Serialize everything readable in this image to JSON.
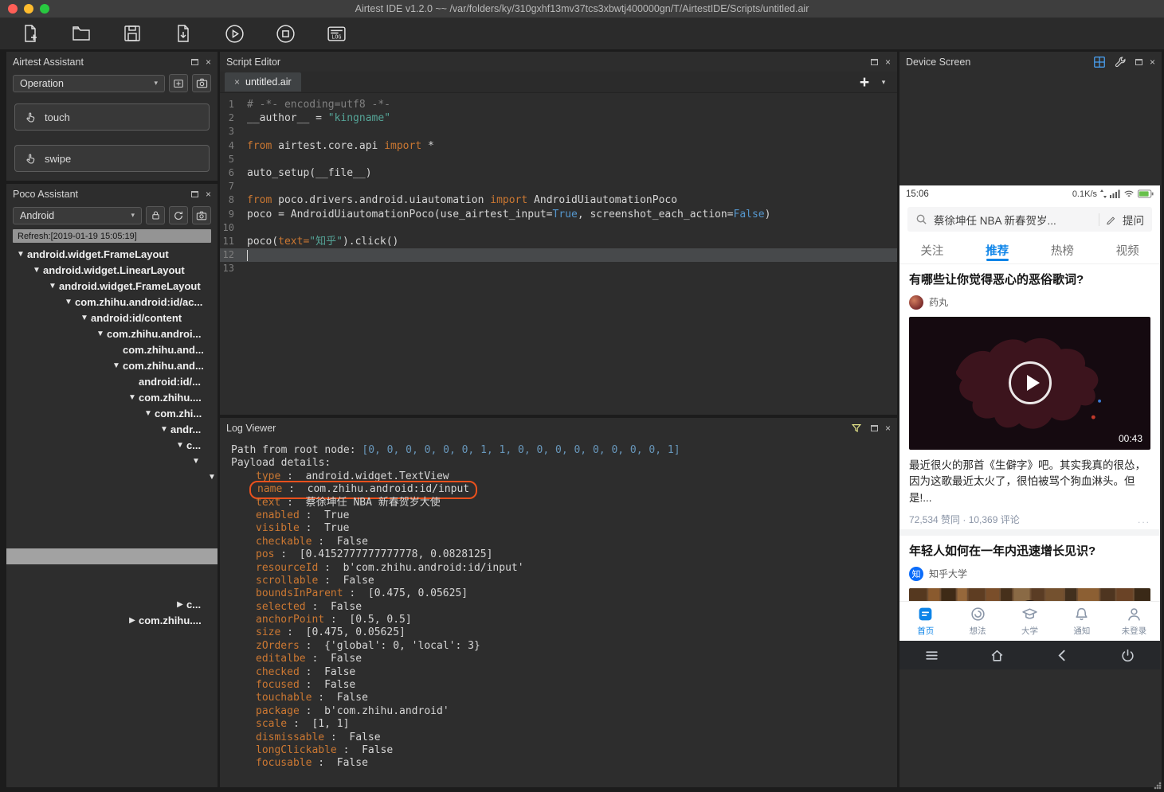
{
  "glyphs": {
    "close": "×",
    "caret": "▾",
    "plus": "+",
    "expanded": "▼",
    "collapsed": "▶"
  },
  "colors": {
    "accent_blue": "#0d84e8",
    "keyword_orange": "#cc7832",
    "string_teal": "#55a598",
    "bool_blue": "#5597ce",
    "highlight_ring": "#e9511d"
  },
  "titlebar": {
    "title": "Airtest IDE v1.2.0 ~~ /var/folders/ky/310gxhf13mv37tcs3xbwtj400000gn/T/AirtestIDE/Scripts/untitled.air"
  },
  "toolbar": {
    "buttons": [
      "new-script",
      "open-script",
      "save-script",
      "export-script",
      "run-script",
      "stop-script",
      "view-log"
    ]
  },
  "airtest_assistant": {
    "title": "Airtest Assistant",
    "mode_selected": "Operation",
    "touch_label": "touch",
    "swipe_label": "swipe"
  },
  "poco_assistant": {
    "title": "Poco Assistant",
    "platform_selected": "Android",
    "refresh_label": "Refresh:[2019-01-19 15:05:19]",
    "tree": [
      {
        "level": 0,
        "label": "android.widget.FrameLayout",
        "state": "expanded"
      },
      {
        "level": 1,
        "label": "android.widget.LinearLayout",
        "state": "expanded"
      },
      {
        "level": 2,
        "label": "android.widget.FrameLayout",
        "state": "expanded"
      },
      {
        "level": 3,
        "label": "com.zhihu.android:id/ac...",
        "state": "expanded"
      },
      {
        "level": 4,
        "label": "android:id/content",
        "state": "expanded"
      },
      {
        "level": 5,
        "label": "com.zhihu.androi...",
        "state": "expanded"
      },
      {
        "level": 6,
        "label": "com.zhihu.and...",
        "state": "leaf"
      },
      {
        "level": 6,
        "label": "com.zhihu.and...",
        "state": "expanded"
      },
      {
        "level": 7,
        "label": "android:id/...",
        "state": "leaf"
      },
      {
        "level": 7,
        "label": "com.zhihu....",
        "state": "expanded"
      },
      {
        "level": 8,
        "label": "com.zhi...",
        "state": "expanded"
      },
      {
        "level": 9,
        "label": "andr...",
        "state": "expanded"
      },
      {
        "level": 10,
        "label": "c...",
        "state": "expanded"
      },
      {
        "level": 11,
        "label": "",
        "state": "expanded"
      },
      {
        "level": 12,
        "label": "",
        "state": "expanded"
      },
      {
        "level": 13,
        "label": "",
        "state": "expanded"
      },
      {
        "level": 14,
        "label": "",
        "state": "expanded"
      },
      {
        "level": 15,
        "label": "",
        "state": "expanded"
      },
      {
        "level": 16,
        "label": "",
        "state": "expanded"
      },
      {
        "level": 17,
        "label": "",
        "state": "expanded",
        "selected": true
      },
      {
        "level": 18,
        "label": "",
        "state": "expanded"
      },
      {
        "level": 19,
        "label": "",
        "state": "expanded"
      },
      {
        "level": 10,
        "label": "c...",
        "state": "collapsed"
      },
      {
        "level": 7,
        "label": "com.zhihu....",
        "state": "collapsed"
      }
    ]
  },
  "script_editor": {
    "title": "Script Editor",
    "tab_label": "untitled.air",
    "lines": [
      {
        "no": 1,
        "segs": [
          {
            "t": "# -*- encoding=utf8 -*-",
            "c": "com"
          }
        ]
      },
      {
        "no": 2,
        "segs": [
          {
            "t": "__author__ = ",
            "c": "pln"
          },
          {
            "t": "\"kingname\"",
            "c": "str"
          }
        ]
      },
      {
        "no": 3,
        "segs": []
      },
      {
        "no": 4,
        "segs": [
          {
            "t": "from",
            "c": "kw"
          },
          {
            "t": " airtest.core.api ",
            "c": "pln"
          },
          {
            "t": "import",
            "c": "kw"
          },
          {
            "t": " *",
            "c": "pln"
          }
        ]
      },
      {
        "no": 5,
        "segs": []
      },
      {
        "no": 6,
        "segs": [
          {
            "t": "auto_setup(__file__)",
            "c": "pln"
          }
        ]
      },
      {
        "no": 7,
        "segs": []
      },
      {
        "no": 8,
        "segs": [
          {
            "t": "from",
            "c": "kw"
          },
          {
            "t": " poco.drivers.android.uiautomation ",
            "c": "pln"
          },
          {
            "t": "import",
            "c": "kw"
          },
          {
            "t": " AndroidUiautomationPoco",
            "c": "pln"
          }
        ]
      },
      {
        "no": 9,
        "segs": [
          {
            "t": "poco = AndroidUiautomationPoco(use_airtest_input=",
            "c": "pln"
          },
          {
            "t": "True",
            "c": "bool"
          },
          {
            "t": ", screenshot_each_action=",
            "c": "pln"
          },
          {
            "t": "False",
            "c": "bool"
          },
          {
            "t": ")",
            "c": "pln"
          }
        ]
      },
      {
        "no": 10,
        "segs": []
      },
      {
        "no": 11,
        "segs": [
          {
            "t": "poco(",
            "c": "pln"
          },
          {
            "t": "text=",
            "c": "kw"
          },
          {
            "t": "\"知乎\"",
            "c": "str"
          },
          {
            "t": ").click()",
            "c": "pln"
          }
        ]
      },
      {
        "no": 12,
        "segs": [],
        "current": true
      },
      {
        "no": 13,
        "segs": []
      }
    ]
  },
  "log_viewer": {
    "title": "Log Viewer",
    "intro": [
      {
        "segs": [
          {
            "t": "Path from root node: ",
            "c": "pln"
          },
          {
            "t": "[0, 0, 0, 0, 0, 0, 1, 1, 0, 0, 0, 0, 0, 0, 0, 0, 1]",
            "c": "num"
          }
        ]
      },
      {
        "segs": [
          {
            "t": "Payload details:",
            "c": "pln"
          }
        ]
      }
    ],
    "payload": [
      {
        "key": "type",
        "value": "android.widget.TextView"
      },
      {
        "key": "name",
        "value": "com.zhihu.android:id/input",
        "highlight": true
      },
      {
        "key": "text",
        "value": "蔡徐坤任 NBA 新春贺岁大使"
      },
      {
        "key": "enabled",
        "value": "True"
      },
      {
        "key": "visible",
        "value": "True"
      },
      {
        "key": "checkable",
        "value": "False"
      },
      {
        "key": "pos",
        "value": "[0.4152777777777778, 0.0828125]"
      },
      {
        "key": "resourceId",
        "value": "b'com.zhihu.android:id/input'"
      },
      {
        "key": "scrollable",
        "value": "False"
      },
      {
        "key": "boundsInParent",
        "value": "[0.475, 0.05625]"
      },
      {
        "key": "selected",
        "value": "False"
      },
      {
        "key": "anchorPoint",
        "value": "[0.5, 0.5]"
      },
      {
        "key": "size",
        "value": "[0.475, 0.05625]"
      },
      {
        "key": "zOrders",
        "value": "{'global': 0, 'local': 3}"
      },
      {
        "key": "editalbe",
        "value": "False"
      },
      {
        "key": "checked",
        "value": "False"
      },
      {
        "key": "focused",
        "value": "False"
      },
      {
        "key": "touchable",
        "value": "False"
      },
      {
        "key": "package",
        "value": "b'com.zhihu.android'"
      },
      {
        "key": "scale",
        "value": "[1, 1]"
      },
      {
        "key": "dismissable",
        "value": "False"
      },
      {
        "key": "longClickable",
        "value": "False"
      },
      {
        "key": "focusable",
        "value": "False"
      }
    ]
  },
  "device_screen": {
    "title": "Device Screen",
    "status": {
      "time": "15:06",
      "net": "0.1K/s"
    },
    "search": {
      "query": "蔡徐坤任 NBA 新春贺岁...",
      "ask": "提问"
    },
    "tabs": [
      {
        "label": "关注"
      },
      {
        "label": "推荐",
        "active": true
      },
      {
        "label": "热榜"
      },
      {
        "label": "视频"
      }
    ],
    "feed": [
      {
        "question": "有哪些让你觉得恶心的恶俗歌词?",
        "author": "药丸",
        "duration": "00:43",
        "excerpt": "最近很火的那首《生僻字》吧。其实我真的很怂，因为这歌最近太火了，很怕被骂个狗血淋头。但是!...",
        "meta": "72,534 赞同 · 10,369 评论",
        "more": "..."
      },
      {
        "question": "年轻人如何在一年内迅速增长见识?",
        "author": "知乎大学",
        "avatar_text": "知"
      }
    ],
    "bottom_nav": [
      {
        "label": "首页",
        "active": true
      },
      {
        "label": "想法"
      },
      {
        "label": "大学"
      },
      {
        "label": "通知"
      },
      {
        "label": "未登录"
      }
    ]
  }
}
